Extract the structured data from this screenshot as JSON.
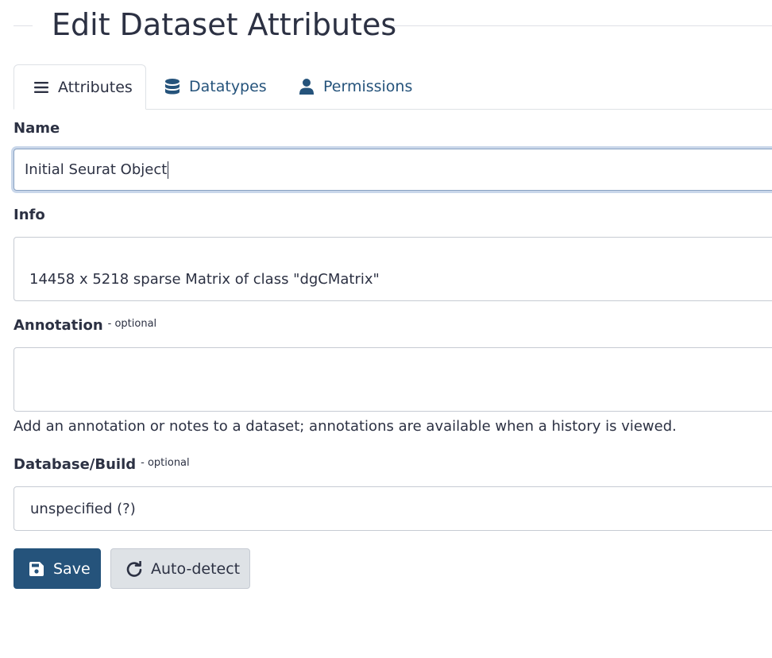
{
  "page": {
    "title": "Edit Dataset Attributes"
  },
  "tabs": [
    {
      "label": "Attributes",
      "icon": "bars-icon",
      "active": true
    },
    {
      "label": "Datatypes",
      "icon": "database-icon",
      "active": false
    },
    {
      "label": "Permissions",
      "icon": "user-icon",
      "active": false
    }
  ],
  "form": {
    "name": {
      "label": "Name",
      "value": "Initial Seurat Object"
    },
    "info": {
      "label": "Info",
      "value": "14458 x 5218 sparse Matrix of class \"dgCMatrix\""
    },
    "annotation": {
      "label": "Annotation",
      "optional_note": "- optional",
      "value": "",
      "help": "Add an annotation or notes to a dataset; annotations are available when a history is viewed."
    },
    "dbkey": {
      "label": "Database/Build",
      "optional_note": "- optional",
      "value": "unspecified (?)"
    }
  },
  "actions": {
    "save_label": "Save",
    "autodetect_label": "Auto-detect"
  },
  "colors": {
    "primary": "#25537b",
    "text": "#2c3143",
    "border": "#c6cbd3",
    "secondary_bg": "#dee2e6"
  }
}
